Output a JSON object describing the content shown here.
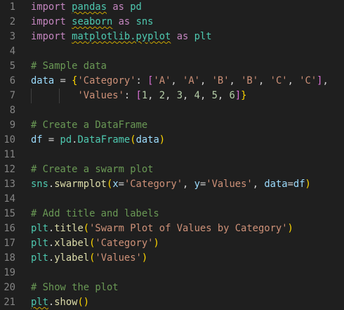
{
  "editor": {
    "lines": [
      {
        "n": "1",
        "tokens": [
          {
            "t": "import",
            "c": "kw"
          },
          {
            "t": " "
          },
          {
            "t": "pandas",
            "c": "mod",
            "sq": true
          },
          {
            "t": " "
          },
          {
            "t": "as",
            "c": "kw"
          },
          {
            "t": " "
          },
          {
            "t": "pd",
            "c": "mod"
          }
        ]
      },
      {
        "n": "2",
        "tokens": [
          {
            "t": "import",
            "c": "kw"
          },
          {
            "t": " "
          },
          {
            "t": "seaborn",
            "c": "mod",
            "sq": true
          },
          {
            "t": " "
          },
          {
            "t": "as",
            "c": "kw"
          },
          {
            "t": " "
          },
          {
            "t": "sns",
            "c": "mod"
          }
        ]
      },
      {
        "n": "3",
        "tokens": [
          {
            "t": "import",
            "c": "kw"
          },
          {
            "t": " "
          },
          {
            "t": "matplotlib.pyplot",
            "c": "mod",
            "sq": true
          },
          {
            "t": " "
          },
          {
            "t": "as",
            "c": "kw"
          },
          {
            "t": " "
          },
          {
            "t": "plt",
            "c": "mod"
          }
        ]
      },
      {
        "n": "4",
        "tokens": []
      },
      {
        "n": "5",
        "tokens": [
          {
            "t": "# Sample data",
            "c": "cm"
          }
        ]
      },
      {
        "n": "6",
        "tokens": [
          {
            "t": "data",
            "c": "var"
          },
          {
            "t": " = "
          },
          {
            "t": "{",
            "c": "b1"
          },
          {
            "t": "'Category'",
            "c": "str"
          },
          {
            "t": ": "
          },
          {
            "t": "[",
            "c": "b2"
          },
          {
            "t": "'A'",
            "c": "str"
          },
          {
            "t": ", "
          },
          {
            "t": "'A'",
            "c": "str"
          },
          {
            "t": ", "
          },
          {
            "t": "'B'",
            "c": "str"
          },
          {
            "t": ", "
          },
          {
            "t": "'B'",
            "c": "str"
          },
          {
            "t": ", "
          },
          {
            "t": "'C'",
            "c": "str"
          },
          {
            "t": ", "
          },
          {
            "t": "'C'",
            "c": "str"
          },
          {
            "t": "]",
            "c": "b2"
          },
          {
            "t": ","
          }
        ]
      },
      {
        "n": "7",
        "guides": true,
        "tokens": [
          {
            "t": "        "
          },
          {
            "t": "'Values'",
            "c": "str"
          },
          {
            "t": ": "
          },
          {
            "t": "[",
            "c": "b2"
          },
          {
            "t": "1",
            "c": "num"
          },
          {
            "t": ", "
          },
          {
            "t": "2",
            "c": "num"
          },
          {
            "t": ", "
          },
          {
            "t": "3",
            "c": "num"
          },
          {
            "t": ", "
          },
          {
            "t": "4",
            "c": "num"
          },
          {
            "t": ", "
          },
          {
            "t": "5",
            "c": "num"
          },
          {
            "t": ", "
          },
          {
            "t": "6",
            "c": "num"
          },
          {
            "t": "]",
            "c": "b2"
          },
          {
            "t": "}",
            "c": "b1"
          }
        ]
      },
      {
        "n": "8",
        "tokens": []
      },
      {
        "n": "9",
        "tokens": [
          {
            "t": "# Create a DataFrame",
            "c": "cm"
          }
        ]
      },
      {
        "n": "10",
        "tokens": [
          {
            "t": "df",
            "c": "var"
          },
          {
            "t": " = "
          },
          {
            "t": "pd",
            "c": "mod"
          },
          {
            "t": "."
          },
          {
            "t": "DataFrame",
            "c": "mod"
          },
          {
            "t": "(",
            "c": "b1"
          },
          {
            "t": "data",
            "c": "var"
          },
          {
            "t": ")",
            "c": "b1"
          }
        ]
      },
      {
        "n": "11",
        "tokens": []
      },
      {
        "n": "12",
        "tokens": [
          {
            "t": "# Create a swarm plot",
            "c": "cm"
          }
        ]
      },
      {
        "n": "13",
        "tokens": [
          {
            "t": "sns",
            "c": "mod"
          },
          {
            "t": "."
          },
          {
            "t": "swarmplot",
            "c": "fn"
          },
          {
            "t": "(",
            "c": "b1"
          },
          {
            "t": "x",
            "c": "var"
          },
          {
            "t": "="
          },
          {
            "t": "'Category'",
            "c": "str"
          },
          {
            "t": ", "
          },
          {
            "t": "y",
            "c": "var"
          },
          {
            "t": "="
          },
          {
            "t": "'Values'",
            "c": "str"
          },
          {
            "t": ", "
          },
          {
            "t": "data",
            "c": "var"
          },
          {
            "t": "="
          },
          {
            "t": "df",
            "c": "var"
          },
          {
            "t": ")",
            "c": "b1"
          }
        ]
      },
      {
        "n": "14",
        "tokens": []
      },
      {
        "n": "15",
        "tokens": [
          {
            "t": "# Add title and labels",
            "c": "cm"
          }
        ]
      },
      {
        "n": "16",
        "tokens": [
          {
            "t": "plt",
            "c": "mod"
          },
          {
            "t": "."
          },
          {
            "t": "title",
            "c": "fn"
          },
          {
            "t": "(",
            "c": "b1"
          },
          {
            "t": "'Swarm Plot of Values by Category'",
            "c": "str"
          },
          {
            "t": ")",
            "c": "b1"
          }
        ]
      },
      {
        "n": "17",
        "tokens": [
          {
            "t": "plt",
            "c": "mod"
          },
          {
            "t": "."
          },
          {
            "t": "xlabel",
            "c": "fn"
          },
          {
            "t": "(",
            "c": "b1"
          },
          {
            "t": "'Category'",
            "c": "str"
          },
          {
            "t": ")",
            "c": "b1"
          }
        ]
      },
      {
        "n": "18",
        "tokens": [
          {
            "t": "plt",
            "c": "mod"
          },
          {
            "t": "."
          },
          {
            "t": "ylabel",
            "c": "fn"
          },
          {
            "t": "(",
            "c": "b1"
          },
          {
            "t": "'Values'",
            "c": "str"
          },
          {
            "t": ")",
            "c": "b1"
          }
        ]
      },
      {
        "n": "19",
        "tokens": []
      },
      {
        "n": "20",
        "tokens": [
          {
            "t": "# Show the plot",
            "c": "cm"
          }
        ]
      },
      {
        "n": "21",
        "tokens": [
          {
            "t": "plt",
            "c": "mod",
            "sq": true
          },
          {
            "t": "."
          },
          {
            "t": "show",
            "c": "fn"
          },
          {
            "t": "(",
            "c": "b1"
          },
          {
            "t": ")",
            "c": "b1"
          }
        ]
      }
    ]
  }
}
